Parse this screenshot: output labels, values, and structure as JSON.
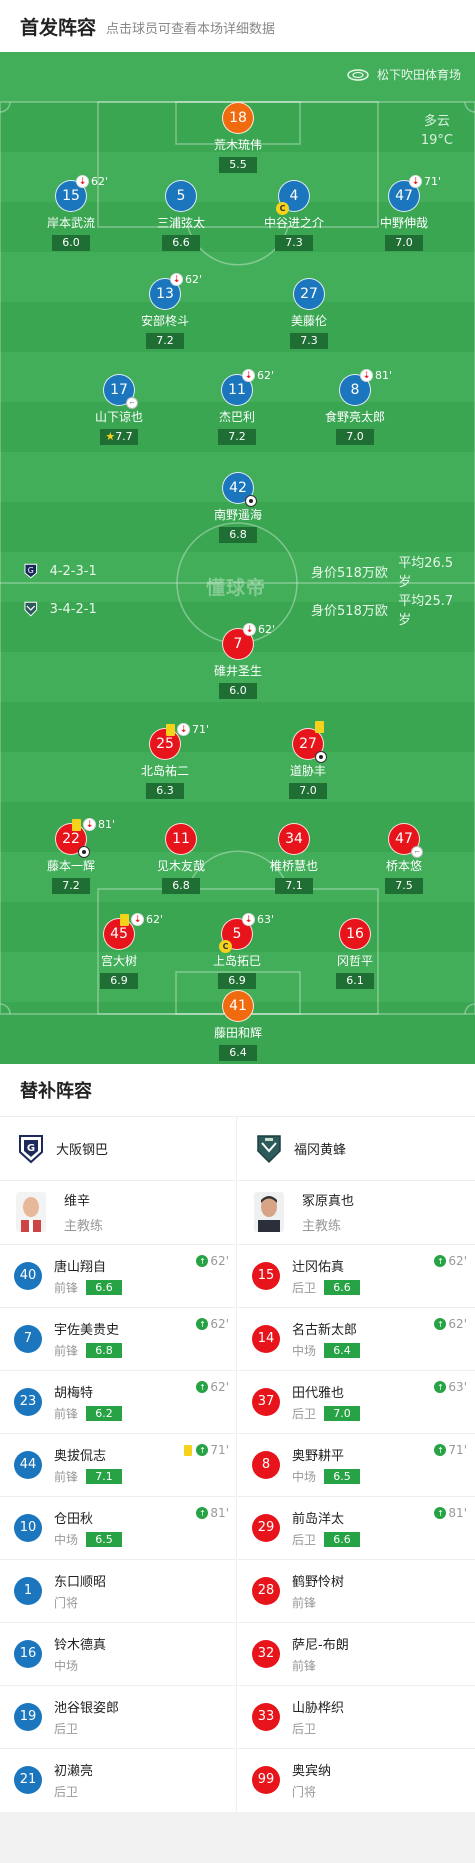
{
  "header": {
    "title": "首发阵容",
    "subtitle": "点击球员可查看本场详细数据"
  },
  "match": {
    "stadium": "松下吹田体育场",
    "weather": "多云",
    "temperature": "19°C",
    "watermark": "懂球帝"
  },
  "home_team": {
    "name": "大阪钢巴",
    "formation": "4-2-3-1",
    "value": "身价518万欧",
    "avg_age": "平均26.5岁"
  },
  "away_team": {
    "name": "福冈黄蜂",
    "formation": "3-4-2-1",
    "value": "身价518万欧",
    "avg_age": "平均25.7岁"
  },
  "home_lineup": [
    {
      "num": "18",
      "name": "荒木琉伟",
      "rating": "5.5",
      "color": "orange"
    },
    {
      "num": "15",
      "name": "岸本武流",
      "rating": "6.0",
      "sub": "62'"
    },
    {
      "num": "5",
      "name": "三浦弦太",
      "rating": "6.6"
    },
    {
      "num": "4",
      "name": "中谷进之介",
      "rating": "7.3",
      "captain": "C"
    },
    {
      "num": "47",
      "name": "中野伸哉",
      "rating": "7.0",
      "sub": "71'"
    },
    {
      "num": "13",
      "name": "安部柊斗",
      "rating": "7.2",
      "sub": "62'"
    },
    {
      "num": "27",
      "name": "美藤伦",
      "rating": "7.3"
    },
    {
      "num": "17",
      "name": "山下谅也",
      "rating": "7.7",
      "star": "★"
    },
    {
      "num": "11",
      "name": "杰巴利",
      "rating": "7.2",
      "sub": "62'"
    },
    {
      "num": "8",
      "name": "食野亮太郎",
      "rating": "7.0",
      "sub": "81'"
    },
    {
      "num": "42",
      "name": "南野遥海",
      "rating": "6.8"
    }
  ],
  "away_lineup": [
    {
      "num": "7",
      "name": "碓井圣生",
      "rating": "6.0",
      "sub": "62'"
    },
    {
      "num": "25",
      "name": "北岛祐二",
      "rating": "6.3",
      "sub": "71'"
    },
    {
      "num": "27",
      "name": "道胁丰",
      "rating": "7.0"
    },
    {
      "num": "22",
      "name": "藤本一辉",
      "rating": "7.2",
      "sub": "81'"
    },
    {
      "num": "11",
      "name": "见木友哉",
      "rating": "6.8"
    },
    {
      "num": "34",
      "name": "椎桥慧也",
      "rating": "7.1"
    },
    {
      "num": "47",
      "name": "桥本悠",
      "rating": "7.5"
    },
    {
      "num": "45",
      "name": "宫大树",
      "rating": "6.9",
      "sub": "62'"
    },
    {
      "num": "5",
      "name": "上岛拓巳",
      "rating": "6.9",
      "sub": "63'",
      "captain": "C"
    },
    {
      "num": "16",
      "name": "冈哲平",
      "rating": "6.1"
    },
    {
      "num": "41",
      "name": "藤田和辉",
      "rating": "6.4",
      "color": "orange"
    }
  ],
  "subs_section": {
    "title": "替补阵容"
  },
  "home_coach": {
    "name": "维辛",
    "role": "主教练"
  },
  "away_coach": {
    "name": "冢原真也",
    "role": "主教练"
  },
  "home_subs": [
    {
      "num": "40",
      "name": "唐山翔自",
      "pos": "前锋",
      "rating": "6.6",
      "on": "62'"
    },
    {
      "num": "7",
      "name": "宇佐美贵史",
      "pos": "前锋",
      "rating": "6.8",
      "on": "62'"
    },
    {
      "num": "23",
      "name": "胡梅特",
      "pos": "前锋",
      "rating": "6.2",
      "on": "62'"
    },
    {
      "num": "44",
      "name": "奥拔侃志",
      "pos": "前锋",
      "rating": "7.1",
      "on": "71'"
    },
    {
      "num": "10",
      "name": "仓田秋",
      "pos": "中场",
      "rating": "6.5",
      "on": "81'"
    },
    {
      "num": "1",
      "name": "东口顺昭",
      "pos": "门将"
    },
    {
      "num": "16",
      "name": "铃木德真",
      "pos": "中场"
    },
    {
      "num": "19",
      "name": "池谷银姿郎",
      "pos": "后卫"
    },
    {
      "num": "21",
      "name": "初濑亮",
      "pos": "后卫"
    }
  ],
  "away_subs": [
    {
      "num": "15",
      "name": "辻冈佑真",
      "pos": "后卫",
      "rating": "6.6",
      "on": "62'"
    },
    {
      "num": "14",
      "name": "名古新太郎",
      "pos": "中场",
      "rating": "6.4",
      "on": "62'"
    },
    {
      "num": "37",
      "name": "田代雅也",
      "pos": "后卫",
      "rating": "7.0",
      "on": "63'"
    },
    {
      "num": "8",
      "name": "奥野耕平",
      "pos": "中场",
      "rating": "6.5",
      "on": "71'"
    },
    {
      "num": "29",
      "name": "前岛洋太",
      "pos": "后卫",
      "rating": "6.6",
      "on": "81'"
    },
    {
      "num": "28",
      "name": "鹤野怜树",
      "pos": "前锋"
    },
    {
      "num": "32",
      "name": "萨尼-布朗",
      "pos": "前锋"
    },
    {
      "num": "33",
      "name": "山胁桦织",
      "pos": "后卫"
    },
    {
      "num": "99",
      "name": "奥宾纳",
      "pos": "门将"
    }
  ],
  "colors": {
    "home": "#1b76bd",
    "away": "#e8141b",
    "goalkeeper": "#f06a0f",
    "pitch": "#3aa652",
    "rating_badge": "#1f6e33",
    "sub_rating": "#27a244"
  }
}
